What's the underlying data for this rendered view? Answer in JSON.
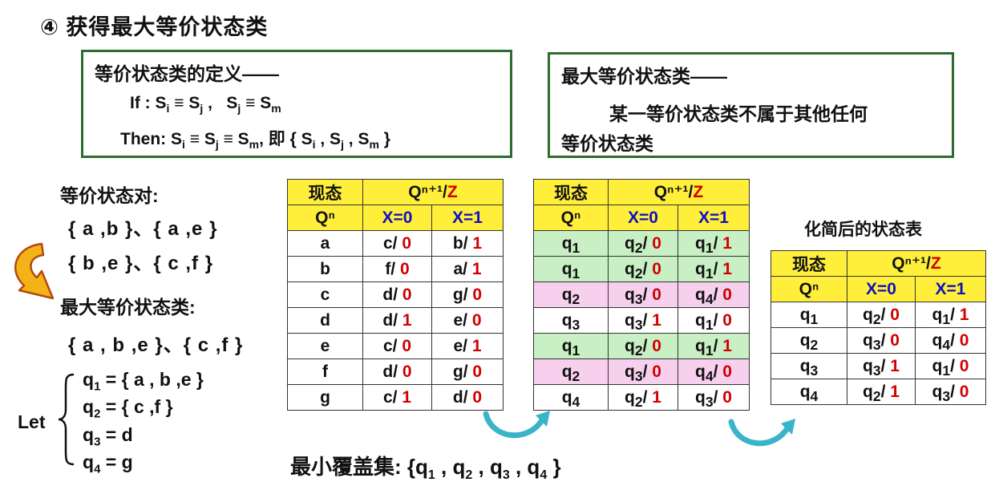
{
  "title": "④ 获得最大等价状态类",
  "def_box": {
    "heading": "等价状态类的定义——",
    "if_line": {
      "label": "If :",
      "html": "S<sub>i</sub> ≡ S<sub>j</sub> ,&nbsp;&nbsp; S<sub>j</sub> ≡ S<sub>m</sub>"
    },
    "then_line": {
      "label": "Then:",
      "html": "S<sub>i</sub> ≡ S<sub>j</sub> ≡ S<sub>m</sub>, 即 { S<sub>i</sub> , S<sub>j</sub> , S<sub>m</sub> }"
    }
  },
  "max_box": {
    "heading": "最大等价状态类——",
    "line1": "某一等价状态类不属于其他任何",
    "line2": "等价状态类"
  },
  "left": {
    "pairs_label": "等价状态对:",
    "pairs_line1": "{ a ,b }、{ a ,e }",
    "pairs_line2": "{ b ,e }、{ c ,f }",
    "max_label": "最大等价状态类:",
    "max_line": "{ a , b ,e }、{ c ,f }",
    "let_label": "Let",
    "let_items": [
      "q<sub>1</sub> = { a , b ,e }",
      "q<sub>2</sub> = { c ,f }",
      "q<sub>3</sub> = d",
      "q<sub>4</sub> = g"
    ]
  },
  "table_header": {
    "state": "现态",
    "qn": "Qⁿ",
    "next": "Qⁿ⁺¹/",
    "z": "Z",
    "x0": "X=0",
    "x1": "X=1"
  },
  "table1": [
    {
      "s": "a",
      "n0": "c",
      "o0": "0",
      "n1": "b",
      "o1": "1"
    },
    {
      "s": "b",
      "n0": "f",
      "o0": "0",
      "n1": "a",
      "o1": "1"
    },
    {
      "s": "c",
      "n0": "d",
      "o0": "0",
      "n1": "g",
      "o1": "0"
    },
    {
      "s": "d",
      "n0": "d",
      "o0": "1",
      "n1": "e",
      "o1": "0"
    },
    {
      "s": "e",
      "n0": "c",
      "o0": "0",
      "n1": "e",
      "o1": "1"
    },
    {
      "s": "f",
      "n0": "d",
      "o0": "0",
      "n1": "g",
      "o1": "0"
    },
    {
      "s": "g",
      "n0": "c",
      "o0": "1",
      "n1": "d",
      "o1": "0"
    }
  ],
  "table2": [
    {
      "s": "q<sub>1</sub>",
      "n0": "q<sub>2</sub>",
      "o0": "0",
      "n1": "q<sub>1</sub>",
      "o1": "1",
      "hl": "g"
    },
    {
      "s": "q<sub>1</sub>",
      "n0": "q<sub>2</sub>",
      "o0": "0",
      "n1": "q<sub>1</sub>",
      "o1": "1",
      "hl": "g"
    },
    {
      "s": "q<sub>2</sub>",
      "n0": "q<sub>3</sub>",
      "o0": "0",
      "n1": "q<sub>4</sub>",
      "o1": "0",
      "hl": "p"
    },
    {
      "s": "q<sub>3</sub>",
      "n0": "q<sub>3</sub>",
      "o0": "1",
      "n1": "q<sub>1</sub>",
      "o1": "0",
      "hl": ""
    },
    {
      "s": "q<sub>1</sub>",
      "n0": "q<sub>2</sub>",
      "o0": "0",
      "n1": "q<sub>1</sub>",
      "o1": "1",
      "hl": "g"
    },
    {
      "s": "q<sub>2</sub>",
      "n0": "q<sub>3</sub>",
      "o0": "0",
      "n1": "q<sub>4</sub>",
      "o1": "0",
      "hl": "p"
    },
    {
      "s": "q<sub>4</sub>",
      "n0": "q<sub>2</sub>",
      "o0": "1",
      "n1": "q<sub>3</sub>",
      "o1": "0",
      "hl": ""
    }
  ],
  "table3_caption": "化简后的状态表",
  "table3": [
    {
      "s": "q<sub>1</sub>",
      "n0": "q<sub>2</sub>",
      "o0": "0",
      "n1": "q<sub>1</sub>",
      "o1": "1"
    },
    {
      "s": "q<sub>2</sub>",
      "n0": "q<sub>3</sub>",
      "o0": "0",
      "n1": "q<sub>4</sub>",
      "o1": "0"
    },
    {
      "s": "q<sub>3</sub>",
      "n0": "q<sub>3</sub>",
      "o0": "1",
      "n1": "q<sub>1</sub>",
      "o1": "0"
    },
    {
      "s": "q<sub>4</sub>",
      "n0": "q<sub>2</sub>",
      "o0": "1",
      "n1": "q<sub>3</sub>",
      "o1": "0"
    }
  ],
  "min_cover": {
    "label": "最小覆盖集:",
    "html": "{q<sub>1</sub> , q<sub>2</sub> , q<sub>3</sub> , q<sub>4</sub> }"
  },
  "colors": {
    "header_fill": "#ffef3a",
    "green_fill": "#c9efc4",
    "pink_fill": "#f7d0ee",
    "red": "#d00000",
    "blue": "#1010c0",
    "box_border": "#2e6b2e",
    "arrow_fill": "#f3b318",
    "curve_arrow": "#39b4c8"
  }
}
